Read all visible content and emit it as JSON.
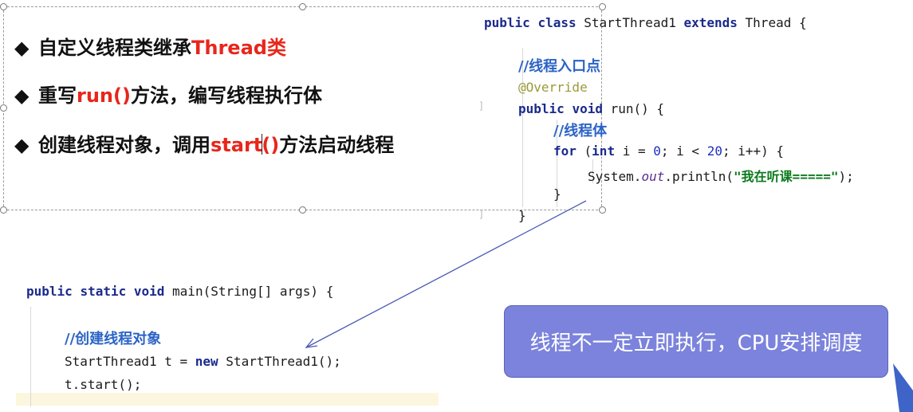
{
  "bullets": {
    "b1_prefix": "自定义线程类继承",
    "b1_red": "Thread类",
    "b2_prefix": "重写",
    "b2_red": "run()",
    "b2_suffix": "方法，编写线程执行体",
    "b3_prefix": "创建线程对象，调用",
    "b3_red_a": "start",
    "b3_red_b": "()",
    "b3_suffix": "方法启动线程",
    "marker": "◆"
  },
  "class_code": {
    "line1_kw1": "public",
    "line1_kw2": "class",
    "line1_name": " StartThread1 ",
    "line1_kw3": "extends",
    "line1_rest": " Thread {",
    "comment1": "//线程入口点",
    "annotation": "@Override",
    "l4_kw1": "public",
    "l4_kw2": "void",
    "l4_rest": " run() {",
    "comment2": "//线程体",
    "for_kw": "for",
    "for_p1": " (",
    "for_int": "int",
    "for_p2": " i = ",
    "for_n0": "0",
    "for_p3": "; i < ",
    "for_n20": "20",
    "for_p4": "; i++) {",
    "print_a": "System.",
    "print_out": "out",
    "print_b": ".println(",
    "print_str": "\"我在听课=====\"",
    "print_c": ");",
    "close_inner": "}",
    "close_outer": "}"
  },
  "main_code": {
    "l1_kw1": "public",
    "l1_kw2": "static",
    "l1_kw3": "void",
    "l1_rest": " main(String[] args) {",
    "comment": "//创建线程对象",
    "l3_a": "StartThread1 t = ",
    "l3_kw": "new",
    "l3_b": " StartThread1();",
    "l4": "t.start();"
  },
  "callout": {
    "text": "线程不一定立即执行，CPU安排调度"
  },
  "colors": {
    "accent_red": "#e8261b",
    "callout_fill": "#7b83dc",
    "keyword": "#1a2a8c",
    "comment": "#2b63c6",
    "string": "#0b7a1c",
    "arrow": "#4a5bb5"
  }
}
